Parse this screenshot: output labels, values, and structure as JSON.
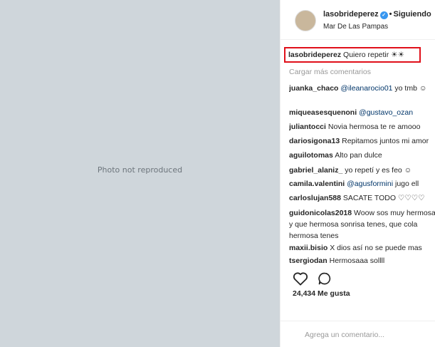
{
  "post": {
    "media_note": "Photo not reproduced"
  },
  "header": {
    "username": "lasobrideperez",
    "separator": "•",
    "follow_label": "Siguiendo",
    "location": "Mar De Las Pampas"
  },
  "caption": {
    "username": "lasobrideperez",
    "text": "Quiero repetir ☀☀"
  },
  "comments": {
    "load_more": "Cargar más comentarios",
    "items": [
      {
        "user": "juanka_chaco",
        "mention": "@ileanarocio01",
        "text": " yo tmb ☺"
      },
      {
        "user": "miqueasesquenoni",
        "mention": "@gustavo_ozan",
        "text": ""
      },
      {
        "user": "juliantocci",
        "mention": "",
        "text": "Novia hermosa te re amooo"
      },
      {
        "user": "dariosigona13",
        "mention": "",
        "text": "Repitamos juntos mi amor"
      },
      {
        "user": "aguilotomas",
        "mention": "",
        "text": "Alto pan dulce"
      },
      {
        "user": "gabriel_alaniz_",
        "mention": "",
        "text": "yo repetí y es feo ☺"
      },
      {
        "user": "camila.valentini",
        "mention": "@agusformini",
        "text": " jugo ell"
      },
      {
        "user": "carloslujan588",
        "mention": "",
        "text": "SACATE TODO ♡♡♡♡"
      },
      {
        "user": "guidonicolas2018",
        "mention": "",
        "text": "Woow sos muy hermosa"
      },
      {
        "user": "",
        "mention": "",
        "text": "y que hermosa sonrisa tenes, que cola"
      },
      {
        "user": "",
        "mention": "",
        "text": "hermosa tenes"
      },
      {
        "user": "maxii.bisio",
        "mention": "",
        "text": "X dios así no se puede mas"
      },
      {
        "user": "tsergiodan",
        "mention": "",
        "text": "Hermosaaa sollll"
      }
    ]
  },
  "actions": {
    "like_icon": "heart-icon",
    "comment_icon": "comment-icon"
  },
  "likes": "24,434 Me gusta",
  "add_comment": {
    "placeholder": "Agrega un comentario..."
  },
  "colors": {
    "highlight_border": "#e0101a",
    "verified": "#3897f0",
    "mention": "#003569"
  }
}
